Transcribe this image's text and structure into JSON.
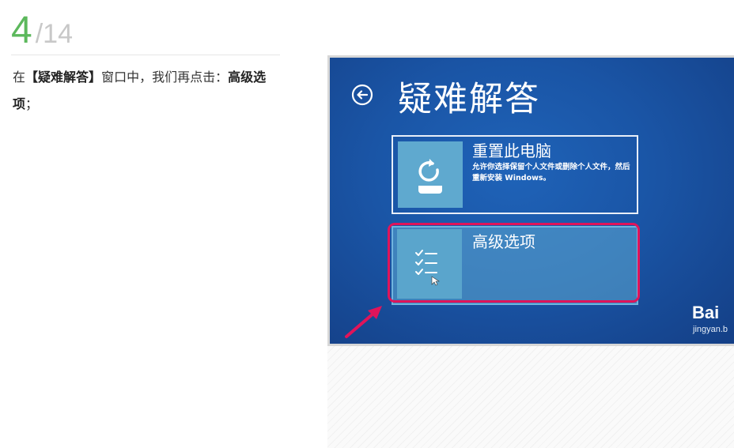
{
  "step": {
    "current": "4",
    "separator": "/",
    "total": "14"
  },
  "instruction": {
    "prefix": "在",
    "bracket_open": "【",
    "target_window": "疑难解答",
    "bracket_close": "】",
    "middle": "窗口中，我们再点击：",
    "option": "高级选项",
    "suffix": "；"
  },
  "screenshot": {
    "title": "疑难解答",
    "options": [
      {
        "title": "重置此电脑",
        "description": "允许你选择保留个人文件或删除个人文件，然后重新安装 Windows。",
        "icon": "reset-pc-icon"
      },
      {
        "title": "高级选项",
        "icon": "checklist-icon"
      }
    ],
    "back_icon": "back-arrow-icon",
    "watermark": {
      "logo": "Bai",
      "sub": "jingyan.b"
    }
  },
  "colors": {
    "step_green": "#5cb85c",
    "highlight": "#e0145a",
    "screen_blue": "#1a55a6"
  }
}
